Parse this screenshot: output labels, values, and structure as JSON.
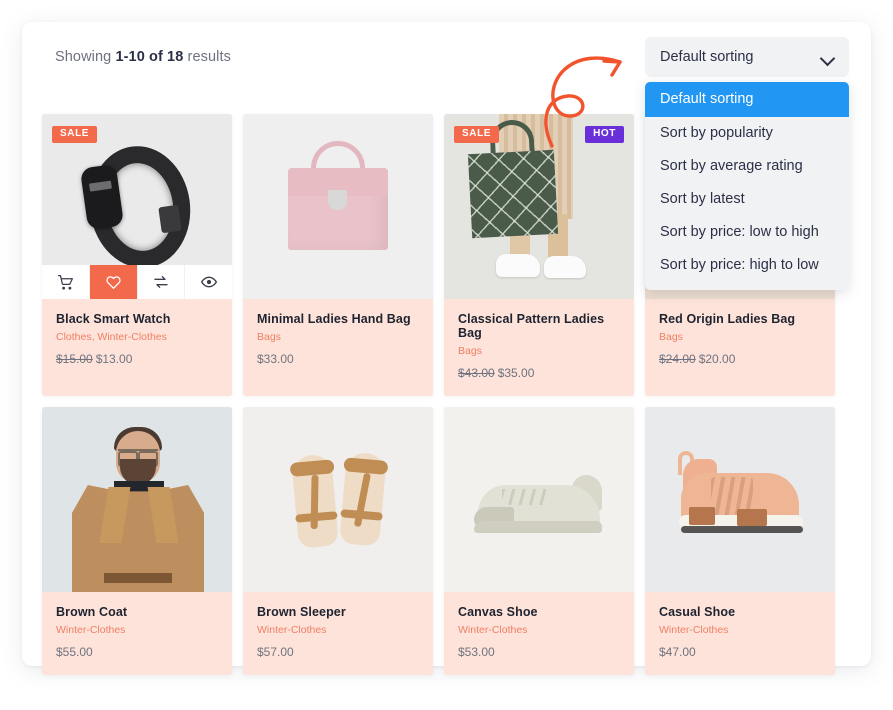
{
  "toolbar": {
    "results_prefix": "Showing",
    "results_range": "1-10 of 18",
    "results_suffix": "results"
  },
  "sorting": {
    "selected_label": "Default sorting",
    "chevron_icon": "chevron-down-icon",
    "options": [
      "Default sorting",
      "Sort by popularity",
      "Sort by average rating",
      "Sort by latest",
      "Sort by price: low to high",
      "Sort by price: high to low"
    ],
    "highlight_color": "#2196f3",
    "panel_bg": "#f1f2f4"
  },
  "badges": {
    "sale": "SALE",
    "hot": "HOT",
    "sale_color": "#f2694b",
    "hot_color": "#6b2fd9"
  },
  "card_actions": {
    "cart": "cart-icon",
    "wishlist": "heart-icon",
    "compare": "compare-icon",
    "quickview": "eye-icon",
    "active_color": "#f2694b"
  },
  "products": [
    {
      "title": "Black Smart Watch",
      "category": "Clothes, Winter-Clothes",
      "old_price": "$15.00",
      "price": "$13.00",
      "sale": true,
      "hot": false,
      "has_actions": true
    },
    {
      "title": "Minimal Ladies Hand Bag",
      "category": "Bags",
      "old_price": "",
      "price": "$33.00",
      "sale": false,
      "hot": false,
      "has_actions": false
    },
    {
      "title": "Classical Pattern Ladies Bag",
      "category": "Bags",
      "old_price": "$43.00",
      "price": "$35.00",
      "sale": true,
      "hot": true,
      "has_actions": false
    },
    {
      "title": "Red Origin Ladies Bag",
      "category": "Bags",
      "old_price": "$24.00",
      "price": "$20.00",
      "sale": false,
      "hot": false,
      "has_actions": false
    },
    {
      "title": "Brown Coat",
      "category": "Winter-Clothes",
      "old_price": "",
      "price": "$55.00",
      "sale": false,
      "hot": false,
      "has_actions": false
    },
    {
      "title": "Brown Sleeper",
      "category": "Winter-Clothes",
      "old_price": "",
      "price": "$57.00",
      "sale": false,
      "hot": false,
      "has_actions": false
    },
    {
      "title": "Canvas Shoe",
      "category": "Winter-Clothes",
      "old_price": "",
      "price": "$53.00",
      "sale": false,
      "hot": false,
      "has_actions": false
    },
    {
      "title": "Casual Shoe",
      "category": "Winter-Clothes",
      "old_price": "",
      "price": "$47.00",
      "sale": false,
      "hot": false,
      "has_actions": false
    }
  ],
  "annotation": {
    "arrow_icon": "curved-arrow-annotation",
    "color": "#f2542d"
  }
}
